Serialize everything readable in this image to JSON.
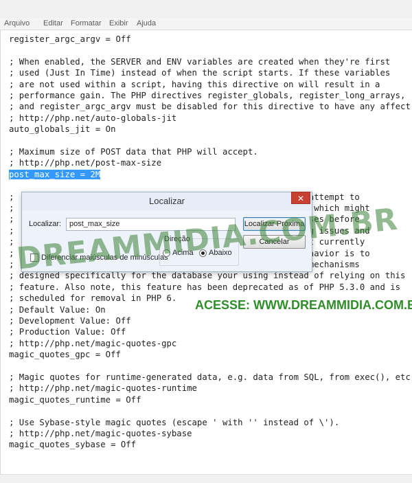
{
  "menu": {
    "items": [
      "Arquivo",
      "Editar",
      "Formatar",
      "Exibir",
      "Ajuda"
    ]
  },
  "editor": {
    "lines": [
      "register_argc_argv = Off",
      "",
      "; When enabled, the SERVER and ENV variables are created when they're first",
      "; used (Just In Time) instead of when the script starts. If these variables",
      "; are not used within a script, having this directive on will result in a",
      "; performance gain. The PHP directives register_globals, register_long_arrays,",
      "; and register_argc_argv must be disabled for this directive to have any affect.",
      "; http://php.net/auto-globals-jit",
      "auto_globals_jit = On",
      "",
      "; Maximum size of POST data that PHP will accept.",
      "; http://php.net/post-max-size",
      "post_max_size = 2M",
      "",
      ";                                                      ill attempt to",
      ";                                                      data which might",
      ";                                                      tabases before",
      ";                                                      oding issues and",
      ";                                                      s not currently",
      ";                                                      t behavior is to",
      ";                                                      ing mechanisms",
      "; designed specifically for the database your using instead of relying on this",
      "; feature. Also note, this feature has been deprecated as of PHP 5.3.0 and is",
      "; scheduled for removal in PHP 6.",
      "; Default Value: On",
      "; Development Value: Off",
      "; Production Value: Off",
      "; http://php.net/magic-quotes-gpc",
      "magic_quotes_gpc = Off",
      "",
      "; Magic quotes for runtime-generated data, e.g. data from SQL, from exec(), etc.",
      "; http://php.net/magic-quotes-runtime",
      "magic_quotes_runtime = Off",
      "",
      "; Use Sybase-style magic quotes (escape ' with '' instead of \\').",
      "; http://php.net/magic-quotes-sybase",
      "magic_quotes_sybase = Off"
    ],
    "selected_line": 12
  },
  "dialog": {
    "title": "Localizar",
    "close_label": "✕",
    "find_label": "Localizar:",
    "find_value": "post_max_size",
    "find_next_label": "Localizar Próxima",
    "cancel_label": "Cancelar",
    "match_case_label": "Diferenciar maiúsculas de minúsculas",
    "direction_label": "Direção",
    "up_label": "Acima",
    "down_label": "Abaixo",
    "direction_selected": "down"
  },
  "watermark": {
    "big": "DREAMMIDIA.COM.BR",
    "small": "ACESSE: WWW.DREAMMIDIA.COM.BR"
  },
  "colors": {
    "selection": "#3399ff",
    "close_button": "#c74233",
    "watermark": "#2f8e2a"
  }
}
